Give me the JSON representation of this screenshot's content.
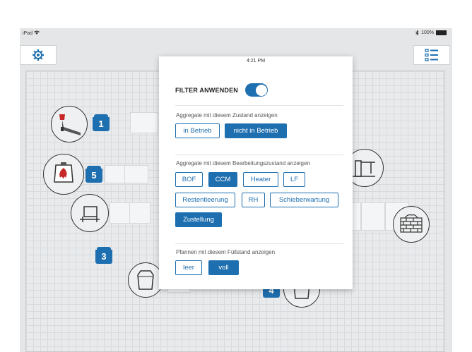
{
  "status_bar": {
    "device": "iPad",
    "wifi_icon": "wifi-icon",
    "time": "4:21 PM",
    "bluetooth_icon": "bluetooth-icon",
    "battery": "100%"
  },
  "toolbar": {
    "settings_icon": "gear-icon",
    "list_icon": "list-icon"
  },
  "plant_map": {
    "ladles": [
      {
        "label": "1"
      },
      {
        "label": "5"
      },
      {
        "label": "3"
      },
      {
        "label": "4"
      }
    ],
    "units": [
      "converter-icon",
      "fire-furnace-icon",
      "heater-icon",
      "crane-icon",
      "ladle-outline-icon",
      "ladle-outline-icon",
      "brick-wall-icon"
    ]
  },
  "filter_panel": {
    "apply_label": "FILTER ANWENDEN",
    "apply_enabled": true,
    "sections": [
      {
        "title": "Aggregate mit diesem Zustand anzeigen",
        "chips": [
          {
            "label": "in Betrieb",
            "selected": false
          },
          {
            "label": "nicht in Betrieb",
            "selected": true
          }
        ]
      },
      {
        "title": "Aggregate mit diesem Bearbeitungszustand anzeigen",
        "chips": [
          {
            "label": "BOF",
            "selected": false
          },
          {
            "label": "CCM",
            "selected": true
          },
          {
            "label": "Heater",
            "selected": false
          },
          {
            "label": "LF",
            "selected": false
          },
          {
            "label": "Restentleerung",
            "selected": false
          },
          {
            "label": "RH",
            "selected": false
          },
          {
            "label": "Schieberwartung",
            "selected": false
          },
          {
            "label": "Zustellung",
            "selected": true
          }
        ]
      },
      {
        "title": "Pfannen mit diesem Füllstand anzeigen",
        "chips": [
          {
            "label": "leer",
            "selected": false
          },
          {
            "label": "voll",
            "selected": true
          }
        ]
      }
    ]
  },
  "colors": {
    "accent": "#1e6fb0",
    "background": "#e4e6e8"
  }
}
